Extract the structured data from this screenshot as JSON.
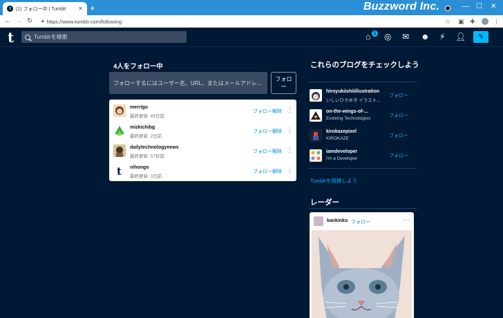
{
  "browser": {
    "tab_title": "(1) フォロー中 | Tumblr",
    "url": "https://www.tumblr.com/following",
    "brand": "Buzzword Inc."
  },
  "header": {
    "logo": "t",
    "search_placeholder": "Tumblrを検索",
    "inbox_badge": "1"
  },
  "following": {
    "heading": "4人をフォロー中",
    "input_placeholder": "フォローするにはユーザー名、URL、またはメールアドレ...",
    "follow_button": "フォロー",
    "unfollow_label": "フォロー解除",
    "items": [
      {
        "name": "merrigo",
        "meta": "最終更新: 69日前"
      },
      {
        "name": "mizkichibg",
        "meta": "最終更新: 2日前"
      },
      {
        "name": "dailytechnologynews",
        "meta": "最終更新: 57秒前"
      },
      {
        "name": "nihongo",
        "meta": "最終更新: 3日前"
      }
    ]
  },
  "recommend": {
    "title": "これらのブログをチェックしよう",
    "follow_label": "フォロー",
    "blogs": [
      {
        "name": "hiroyukiishiiillustration",
        "sub": "いしいひろゆき イラスト..."
      },
      {
        "name": "on-the-wings-of-...",
        "sub": "Evolving Technologies"
      },
      {
        "name": "kirokazepixel",
        "sub": "KIROKAZE"
      },
      {
        "name": "iamdeveloper",
        "sub": "I'm a Developer"
      }
    ],
    "explore_link": "Tumblrを探検しよう"
  },
  "radar": {
    "title": "レーダー",
    "name": "kankinko",
    "follow_label": "フォロー"
  },
  "colors": {
    "background": "#001935",
    "accent": "#00b8ff",
    "titlebar": "#2a8fd6"
  }
}
